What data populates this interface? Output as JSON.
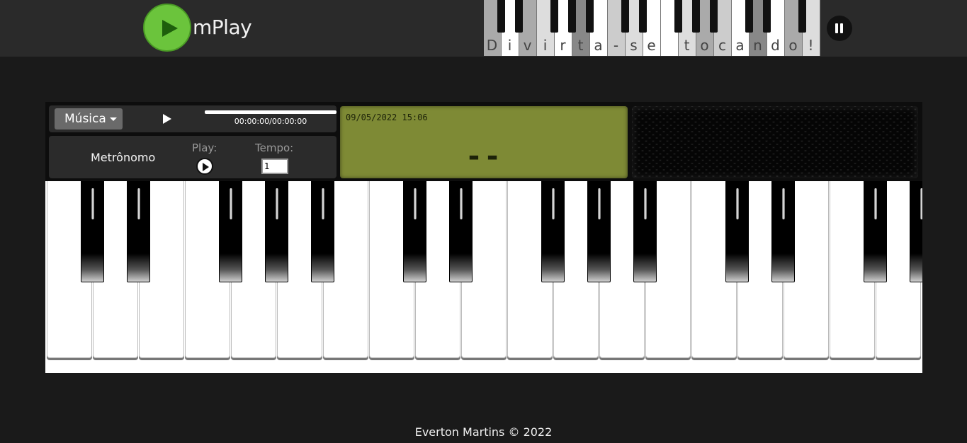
{
  "app": {
    "name": "mPlay",
    "banner_letters": [
      "D",
      "i",
      "v",
      "i",
      "r",
      "t",
      "a",
      "-",
      "s",
      "e",
      " ",
      "t",
      "o",
      "c",
      "a",
      "n",
      "d",
      "o",
      "!"
    ],
    "colors": {
      "logo_green": "#6bc43c",
      "lcd_green": "#7e8a35",
      "background": "#1a1a1a"
    }
  },
  "controls": {
    "music_menu_label": "Música",
    "time_display": "00:00:00/00:00:00",
    "metronome_label": "Metrônomo",
    "play_label": "Play:",
    "tempo_label": "Tempo:",
    "tempo_value": "1"
  },
  "lcd": {
    "datetime": "09/05/2022 15:06",
    "note": "--"
  },
  "keyboard": {
    "white_key_count": 19,
    "black_key_count": 14
  },
  "footer": {
    "text": "Everton Martins © 2022"
  }
}
